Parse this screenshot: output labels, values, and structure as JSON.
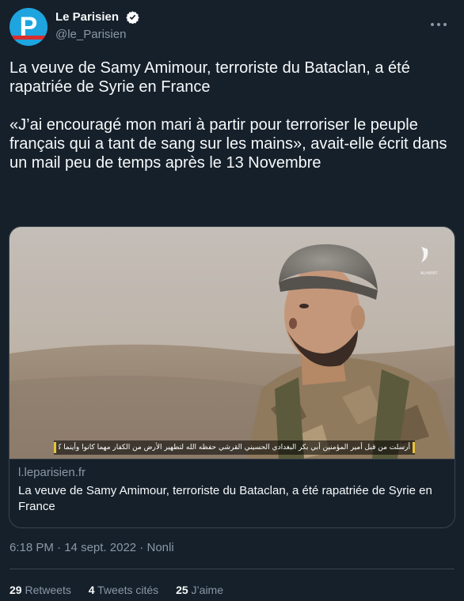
{
  "author": {
    "display_name": "Le Parisien",
    "handle": "@le_Parisien",
    "avatar_letter": "P",
    "verified": true
  },
  "tweet": {
    "paragraph1": "La veuve de Samy Amimour, terroriste du Bataclan, a été rapatriée de Syrie en France",
    "paragraph2": "«J’ai encouragé mon mari à partir pour terroriser le peuple français qui a tant de sang sur les mains», avait-elle écrit dans un mail peu de temps après le 13 Novembre"
  },
  "card": {
    "domain": "l.leparisien.fr",
    "title": "La veuve de Samy Amimour, terroriste du Bataclan, a été rapatriée de Syrie en France",
    "image_caption": "أرسلت من قبل أمير المؤمنين أبي بكر البغدادي الحسيني القرشي حفظه الله لتطهير الأرض من الكفار مهما كانوا وأينما كانوا",
    "image_watermark": "ALHAYAT"
  },
  "meta": {
    "time": "6:18 PM",
    "date": "14 sept. 2022",
    "source": "Nonli",
    "separator": " · "
  },
  "stats": {
    "retweets_count": "29",
    "retweets_label": "Retweets",
    "quotes_count": "4",
    "quotes_label": "Tweets cités",
    "likes_count": "25",
    "likes_label": "J’aime"
  },
  "colors": {
    "background": "#15202b",
    "text": "#f7f9f9",
    "secondary": "#8b98a5",
    "border": "#38444d",
    "avatar_blue": "#1ea5e0",
    "verified_blue": "#1d9bf0"
  }
}
